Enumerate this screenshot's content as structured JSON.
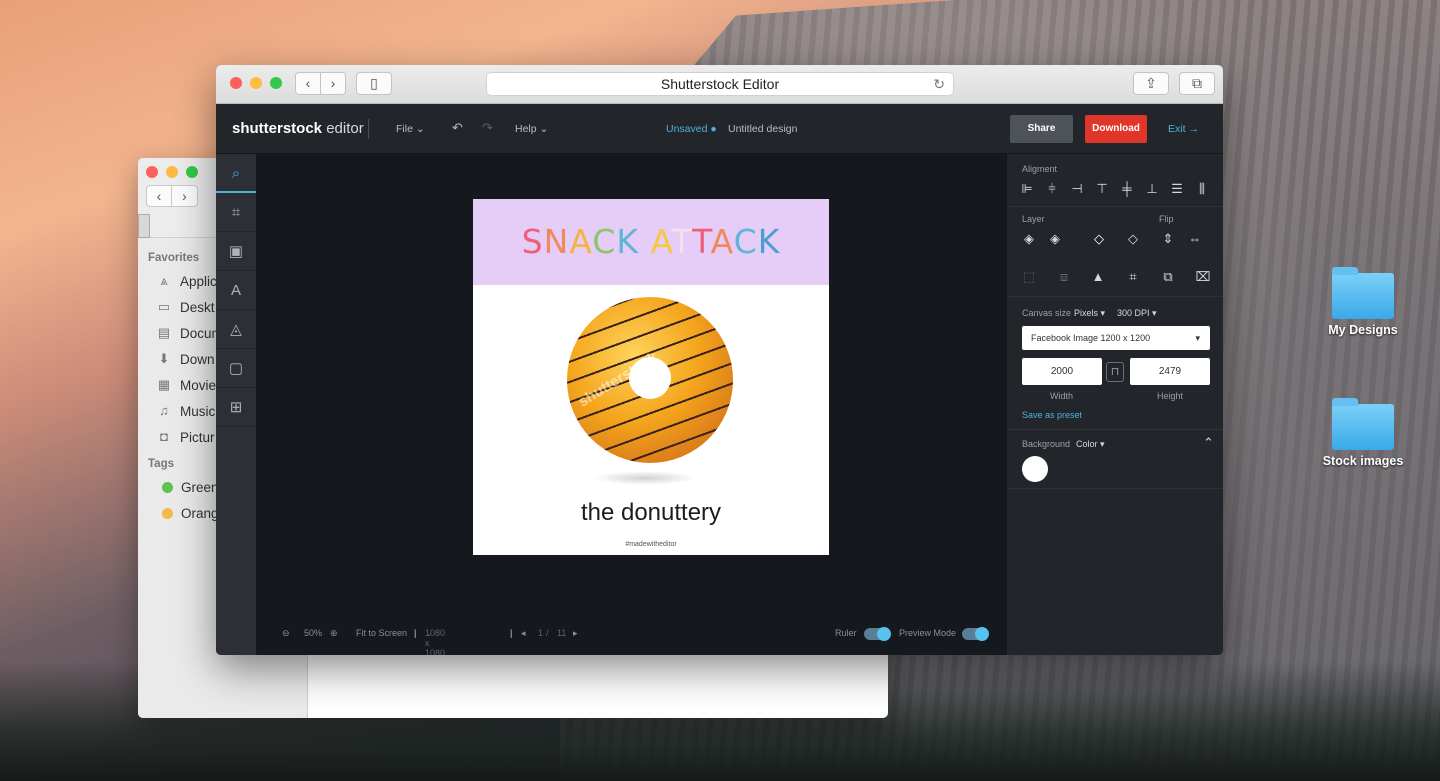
{
  "desktop": {
    "icons": [
      {
        "label": "My Designs"
      },
      {
        "label": "Stock images"
      }
    ]
  },
  "finder": {
    "favorites_header": "Favorites",
    "favorites": [
      "Applic",
      "Deskt",
      "Docum",
      "Down",
      "Movie",
      "Music",
      "Pictur"
    ],
    "tags_header": "Tags",
    "tags": [
      {
        "label": "Green",
        "color": "#5dc34b"
      },
      {
        "label": "Orang",
        "color": "#f4b94a"
      }
    ]
  },
  "safari": {
    "url_title": "Shutterstock Editor"
  },
  "editor": {
    "logo_bold": "shutterstock",
    "logo_light": " editor",
    "menu_file": "File",
    "menu_help": "Help",
    "unsaved": "Unsaved",
    "design_name": "Untitled design",
    "share": "Share",
    "download": "Download",
    "exit": "Exit"
  },
  "artboard": {
    "title_letters": [
      {
        "ch": "S",
        "color": "#ef5f7c"
      },
      {
        "ch": "N",
        "color": "#f08a5d"
      },
      {
        "ch": "A",
        "color": "#f5b342"
      },
      {
        "ch": "C",
        "color": "#8ac66a"
      },
      {
        "ch": "K",
        "color": "#5fb5d8"
      },
      {
        "ch": " ",
        "color": "#000000"
      },
      {
        "ch": "A",
        "color": "#f5c842"
      },
      {
        "ch": "T",
        "color": "#f4e1ea"
      },
      {
        "ch": "T",
        "color": "#ef5f7c"
      },
      {
        "ch": "A",
        "color": "#f08a5d"
      },
      {
        "ch": "C",
        "color": "#5fb5d8"
      },
      {
        "ch": "K",
        "color": "#4a9fd0"
      }
    ],
    "watermark": "shutterstock",
    "brand": "the donuttery",
    "tagline": "#madewitheditor"
  },
  "bottom_bar": {
    "zoom": "50%",
    "fit": "Fit to Screen",
    "size": "1080 x 1080 px",
    "page_current": "1",
    "page_sep": "/",
    "page_total": "11",
    "ruler": "Ruler",
    "preview": "Preview Mode"
  },
  "panel": {
    "alignment": "Aligment",
    "layer": "Layer",
    "flip": "Flip",
    "canvas_size": "Canvas size",
    "units": "Pixels",
    "dpi": "300 DPI",
    "preset": "Facebook Image 1200 x 1200",
    "width_value": "2000",
    "height_value": "2479",
    "width_label": "Width",
    "height_label": "Height",
    "save_preset": "Save as preset",
    "background": "Background",
    "bg_mode": "Color"
  }
}
